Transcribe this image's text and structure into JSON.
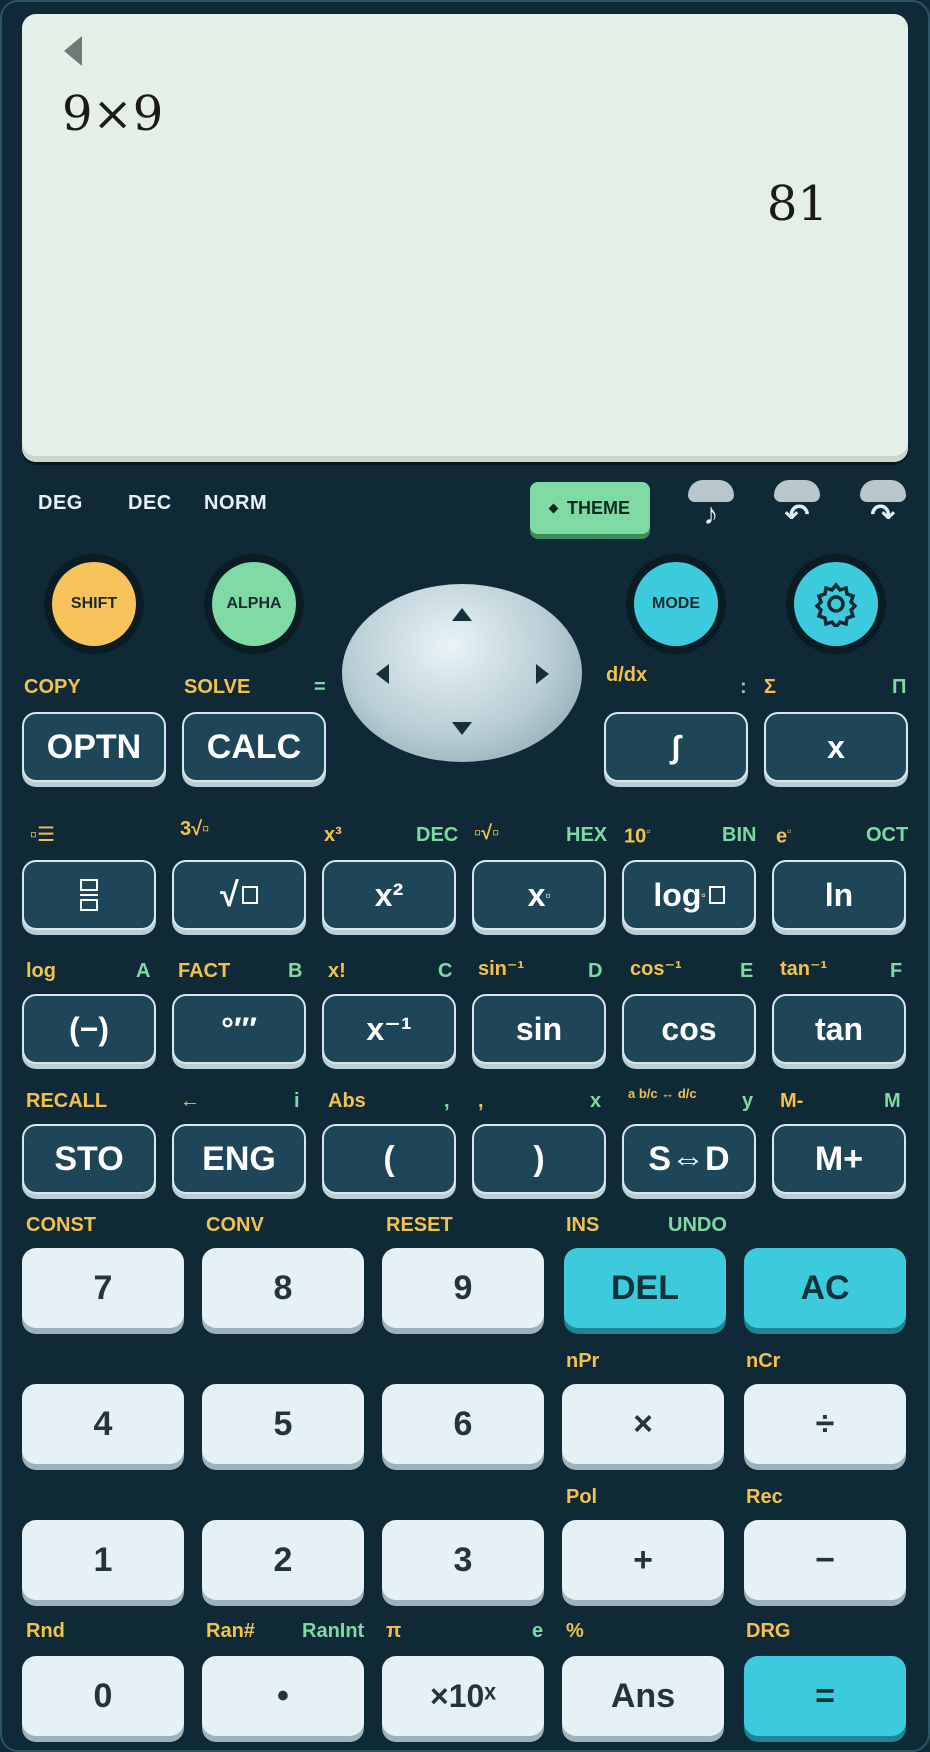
{
  "display": {
    "expression": "9×9",
    "result": "81"
  },
  "status": {
    "angle": "DEG",
    "base": "DEC",
    "format": "NORM",
    "theme_label": "THEME",
    "icons": [
      "music-note-icon",
      "undo-icon",
      "redo-icon"
    ]
  },
  "top_buttons": {
    "shift": "SHIFT",
    "alpha": "ALPHA",
    "mode": "MODE",
    "settings_icon": "gear-icon"
  },
  "labels": {
    "r1": {
      "copy": "COPY",
      "solve": "SOLVE",
      "eq": "=",
      "ddx": "d/dx",
      "colon": ":",
      "sigma": "Σ",
      "pi": "Π"
    },
    "r2": {
      "cube": "x³",
      "dec": "DEC",
      "hex": "HEX",
      "ten": "10",
      "bin": "BIN",
      "e": "e",
      "oct": "OCT",
      "cbrt": "3"
    },
    "r3": {
      "log": "log",
      "a": "A",
      "fact": "FACT",
      "b": "B",
      "xfact": "x!",
      "c": "C",
      "asin": "sin⁻¹",
      "d": "D",
      "acos": "cos⁻¹",
      "e": "E",
      "atan": "tan⁻¹",
      "f": "F"
    },
    "r4": {
      "recall": "RECALL",
      "left": "←",
      "i": "i",
      "abs": "Abs",
      "comma1": ",",
      "comma2": ",",
      "x": "x",
      "frac": "a b/c ↔ d/c",
      "y": "y",
      "mminus": "M-",
      "m": "M"
    },
    "r5": {
      "const": "CONST",
      "conv": "CONV",
      "reset": "RESET",
      "ins": "INS",
      "undo": "UNDO"
    },
    "r6": {
      "npr": "nPr",
      "ncr": "nCr"
    },
    "r7": {
      "pol": "Pol",
      "rec": "Rec"
    },
    "r8": {
      "rnd": "Rnd",
      "ran": "Ran#",
      "ranint": "RanInt",
      "pi": "π",
      "e": "e",
      "pct": "%",
      "drg": "DRG"
    }
  },
  "keys": {
    "optn": "OPTN",
    "calc": "CALC",
    "integral": "∫",
    "x": "x",
    "sqrt": "√",
    "x2": "x²",
    "xsq": "x",
    "log": "log",
    "ln": "ln",
    "neg": "(−)",
    "deg": "°′″",
    "inv": "x⁻¹",
    "sin": "sin",
    "cos": "cos",
    "tan": "tan",
    "sto": "STO",
    "eng": "ENG",
    "lparen": "(",
    "rparen": ")",
    "sd": "S⇔D",
    "mplus": "M+",
    "n7": "7",
    "n8": "8",
    "n9": "9",
    "del": "DEL",
    "ac": "AC",
    "n4": "4",
    "n5": "5",
    "n6": "6",
    "mul": "×",
    "div": "÷",
    "n1": "1",
    "n2": "2",
    "n3": "3",
    "plus": "+",
    "minus": "−",
    "n0": "0",
    "dot": "•",
    "exp": "×10ˣ",
    "ans": "Ans",
    "equals": "="
  }
}
